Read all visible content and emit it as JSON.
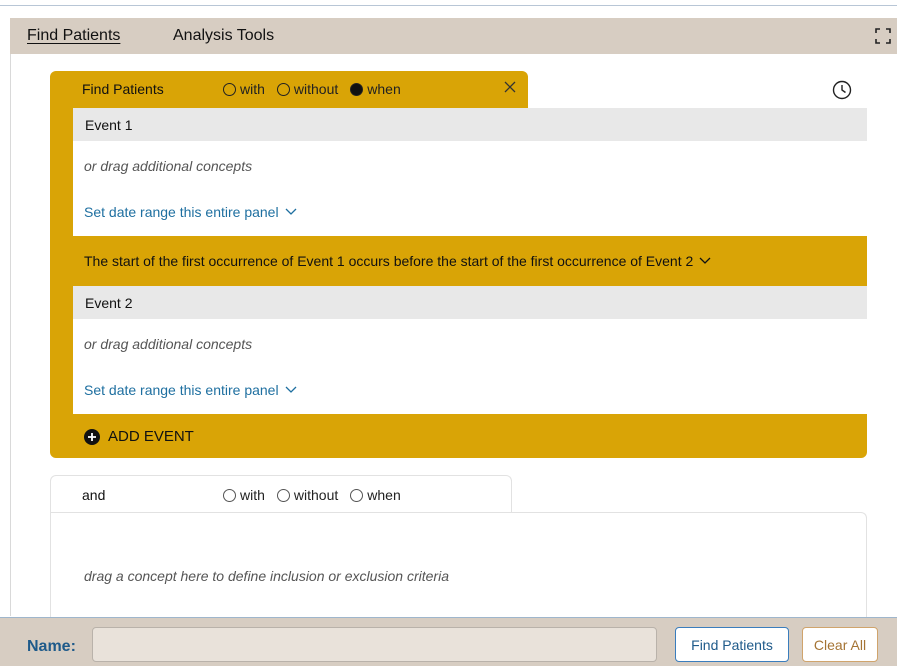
{
  "header": {
    "tabs": [
      {
        "label": "Find Patients",
        "active": true
      },
      {
        "label": "Analysis Tools",
        "active": false
      }
    ]
  },
  "panel1": {
    "title": "Find Patients",
    "options": [
      {
        "label": "with",
        "checked": false
      },
      {
        "label": "without",
        "checked": false
      },
      {
        "label": "when",
        "checked": true
      }
    ],
    "color": "#d9a406",
    "events": [
      {
        "title": "Event 1",
        "drag_text": "or drag additional concepts",
        "date_range_label": "Set date range this entire panel"
      },
      {
        "title": "Event 2",
        "drag_text": "or drag additional concepts",
        "date_range_label": "Set date range this entire panel"
      }
    ],
    "relation_text": "The start of the first occurrence of Event 1 occurs before the start of the first occurrence of Event 2",
    "add_event_label": "ADD EVENT"
  },
  "panel2": {
    "title": "and",
    "options": [
      {
        "label": "with",
        "checked": false
      },
      {
        "label": "without",
        "checked": false
      },
      {
        "label": "when",
        "checked": false
      }
    ],
    "drag_text": "drag a concept here to define inclusion or exclusion criteria"
  },
  "footer": {
    "name_label": "Name:",
    "name_value": "",
    "find_button": "Find Patients",
    "clear_button": "Clear All"
  },
  "icons": {
    "expand": "expand-icon",
    "close": "close-icon",
    "history": "clock-icon",
    "chevron": "chevron-down-icon",
    "add": "plus-circle-icon"
  },
  "colors": {
    "accent_gold": "#d9a406",
    "header_bg": "#d7cdc2",
    "link_blue": "#1e6fa0",
    "find_border": "#3a7dbd",
    "clear_border": "#d0a46c"
  }
}
